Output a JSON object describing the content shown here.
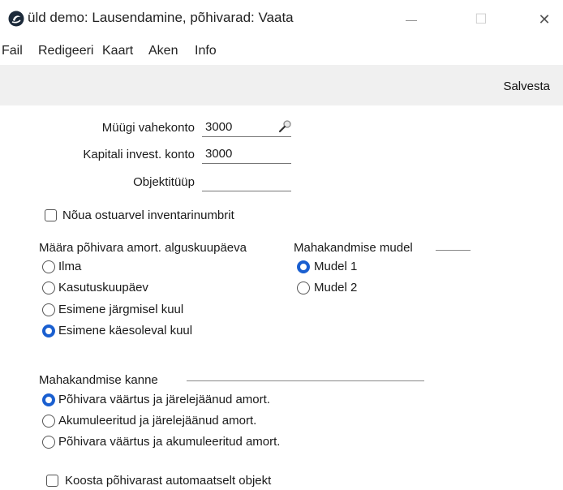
{
  "window": {
    "title": "üld demo: Lausendamine, põhivarad: Vaata",
    "minimize_glyph": "—",
    "maximize_glyph": "☐",
    "close_glyph": "✕"
  },
  "menu": [
    "Fail",
    "Redigeeri",
    "Kaart",
    "Aken",
    "Info"
  ],
  "toolbar": {
    "save_label": "Salvesta"
  },
  "form": {
    "sales_account_label": "Müügi vahekonto",
    "sales_account_value": "3000",
    "capital_account_label": "Kapitali invest. konto",
    "capital_account_value": "3000",
    "object_type_label": "Objektitüüp",
    "object_type_value": "",
    "require_inventory_label": "Nõua ostuarvel inventarinumbrit",
    "require_inventory_checked": false
  },
  "depr_start": {
    "heading": "Määra põhivara amort. alguskuupäeva",
    "options": [
      "Ilma",
      "Kasutuskuupäev",
      "Esimene järgmisel kuul",
      "Esimene käesoleval kuul"
    ],
    "selected": 3
  },
  "writeoff_model": {
    "heading": "Mahakandmise mudel",
    "options": [
      "Mudel 1",
      "Mudel 2"
    ],
    "selected": 0
  },
  "writeoff_entry": {
    "heading": "Mahakandmise kanne",
    "options": [
      "Põhivara väärtus ja järelejäänud amort.",
      "Akumuleeritud ja järelejäänud amort.",
      "Põhivara väärtus ja akumuleeritud amort."
    ],
    "selected": 0
  },
  "auto_object": {
    "label": "Koosta põhivarast automaatselt objekt",
    "checked": false
  },
  "icons": [
    "app-logo-icon",
    "search-icon",
    "minimize-icon",
    "maximize-icon",
    "close-icon"
  ],
  "colors": {
    "accent": "#1a5fd0",
    "toolbar_bg": "#f0f0f0"
  }
}
